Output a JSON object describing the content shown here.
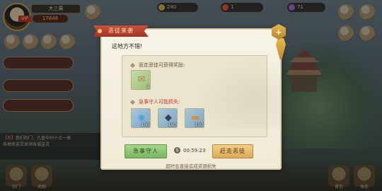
{
  "hud": {
    "player_name": "大三果",
    "vip": "VIP",
    "power": "17848",
    "resources": [
      "240",
      "1",
      "71"
    ]
  },
  "chat": {
    "tag": "【系】",
    "line1": "我们的门，九皇中州十点一来",
    "line2": "各地来送灵来消各城送灵"
  },
  "bottom": {
    "labels": [
      "宗门",
      "地图",
      "背包",
      "角色"
    ]
  },
  "dialog": {
    "title": "恶徒来袭",
    "close": "+",
    "intro": "这地方不错!",
    "reward_title": "驱走恶徒可获得奖励:",
    "loss_title": "急事守人可能损失:",
    "reward_items": [
      {
        "name": "scroll",
        "count": "1"
      }
    ],
    "loss_items": [
      {
        "name": "pouch",
        "count": "100"
      },
      {
        "name": "crystal",
        "count": "100"
      },
      {
        "name": "ingot",
        "count": "100"
      }
    ],
    "buttons": {
      "wake": "急事守人",
      "drive": "赶走恶徒"
    },
    "timer": "00:59:23",
    "footnote": "超时会直接造成资源损失"
  }
}
